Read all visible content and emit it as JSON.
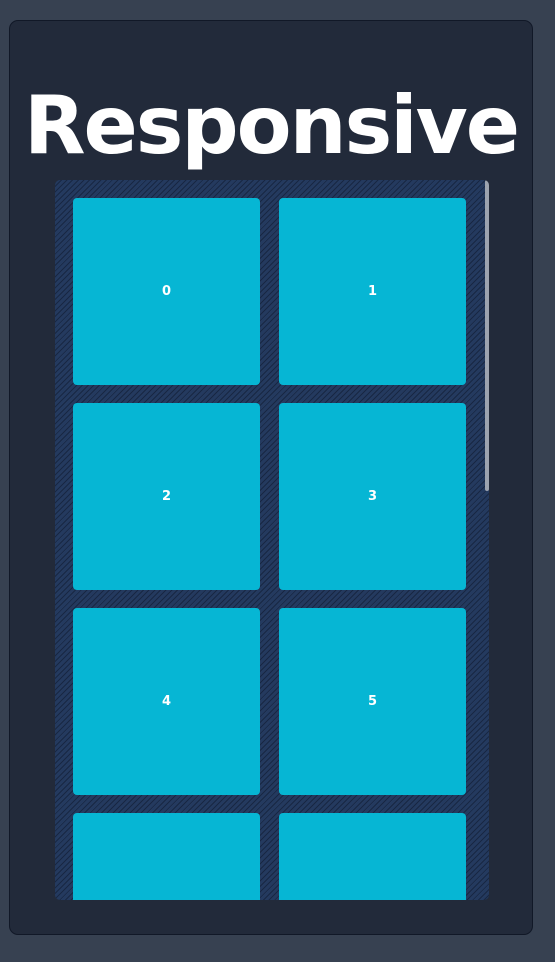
{
  "title": "Responsive",
  "tiles": [
    {
      "label": "0"
    },
    {
      "label": "1"
    },
    {
      "label": "2"
    },
    {
      "label": "3"
    },
    {
      "label": "4"
    },
    {
      "label": "5"
    },
    {
      "label": ""
    },
    {
      "label": ""
    }
  ],
  "colors": {
    "page_background": "#374151",
    "card_background": "#222a3a",
    "container_background": "#243a5f",
    "tile": "#06b6d4",
    "tile_text": "#ffffff",
    "title_text": "#ffffff",
    "scrollbar_thumb": "#9ca3af"
  }
}
